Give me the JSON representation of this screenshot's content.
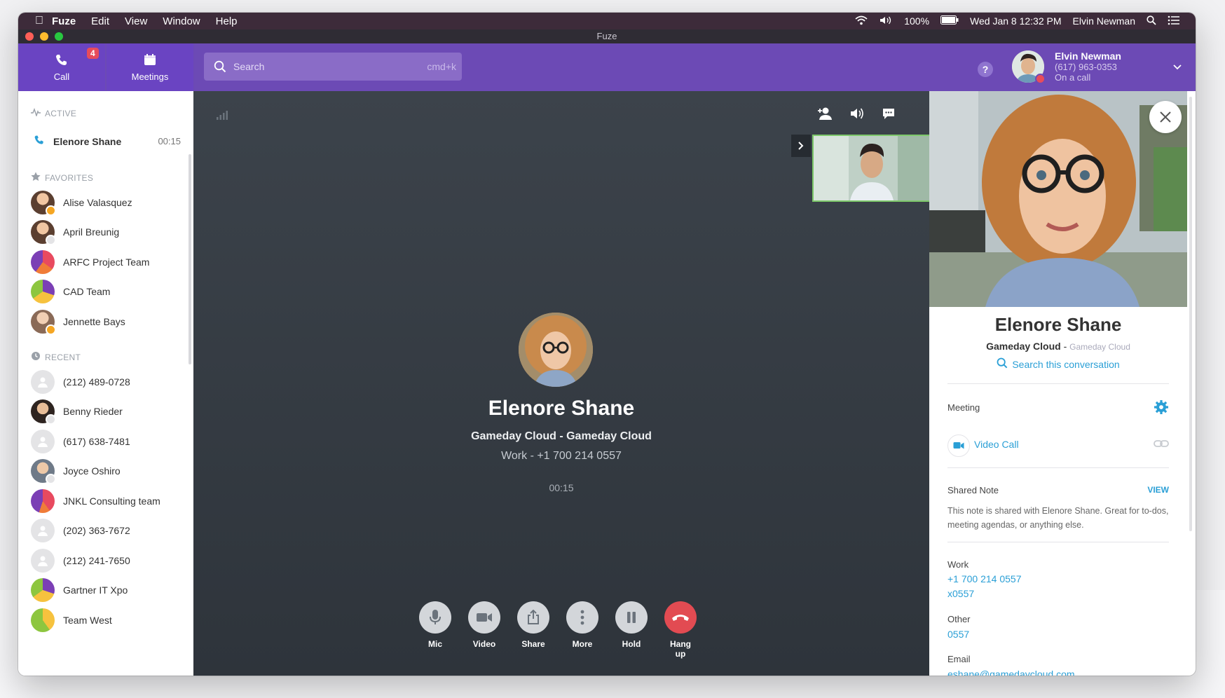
{
  "menubar": {
    "app": "Fuze",
    "items": [
      "Edit",
      "View",
      "Window",
      "Help"
    ],
    "battery": "100%",
    "clock": "Wed Jan 8  12:32 PM",
    "user": "Elvin Newman"
  },
  "window_title": "Fuze",
  "nav": {
    "call_label": "Call",
    "call_badge": "4",
    "meetings_label": "Meetings"
  },
  "search": {
    "placeholder": "Search",
    "shortcut": "cmd+k"
  },
  "help": "?",
  "me": {
    "name": "Elvin Newman",
    "phone": "(617) 963-0353",
    "status": "On a call"
  },
  "sidebar": {
    "active_header": "ACTIVE",
    "active_call": {
      "name": "Elenore Shane",
      "time": "00:15"
    },
    "favorites_header": "FAVORITES",
    "favorites": [
      {
        "name": "Alise Valasquez"
      },
      {
        "name": "April Breunig"
      },
      {
        "name": "ARFC Project Team"
      },
      {
        "name": "CAD Team"
      },
      {
        "name": "Jennette Bays"
      }
    ],
    "recent_header": "RECENT",
    "recent": [
      {
        "name": "(212) 489-0728"
      },
      {
        "name": "Benny Rieder"
      },
      {
        "name": "(617) 638-7481"
      },
      {
        "name": "Joyce Oshiro"
      },
      {
        "name": "JNKL Consulting team"
      },
      {
        "name": "(202) 363-7672"
      },
      {
        "name": "(212) 241-7650"
      },
      {
        "name": "Gartner IT Xpo"
      },
      {
        "name": "Team West"
      }
    ]
  },
  "call": {
    "name": "Elenore Shane",
    "org": "Gameday Cloud - Gameday Cloud",
    "work": "Work - +1 700 214 0557",
    "timer": "00:15",
    "controls": [
      "Mic",
      "Video",
      "Share",
      "More",
      "Hold",
      "Hang up"
    ]
  },
  "panel": {
    "name": "Elenore Shane",
    "company": "Gameday Cloud",
    "separator": "-",
    "company_sub": "Gameday Cloud",
    "search_link": "Search this conversation",
    "meeting_label": "Meeting",
    "video_call": "Video Call",
    "shared_note_label": "Shared Note",
    "view": "VIEW",
    "note_text": "This note is shared with Elenore Shane. Great for to-dos, meeting agendas, or anything else.",
    "work_label": "Work",
    "work_number": "+1 700 214 0557",
    "work_ext": "x0557",
    "other_label": "Other",
    "other_number": "0557",
    "email_label": "Email",
    "email": "eshane@gamedaycloud.com"
  },
  "colors": {
    "header": "#6c4ab5",
    "accent_blue": "#2a9fd6",
    "hangup": "#e24b52",
    "badge": "#e74c5b"
  }
}
